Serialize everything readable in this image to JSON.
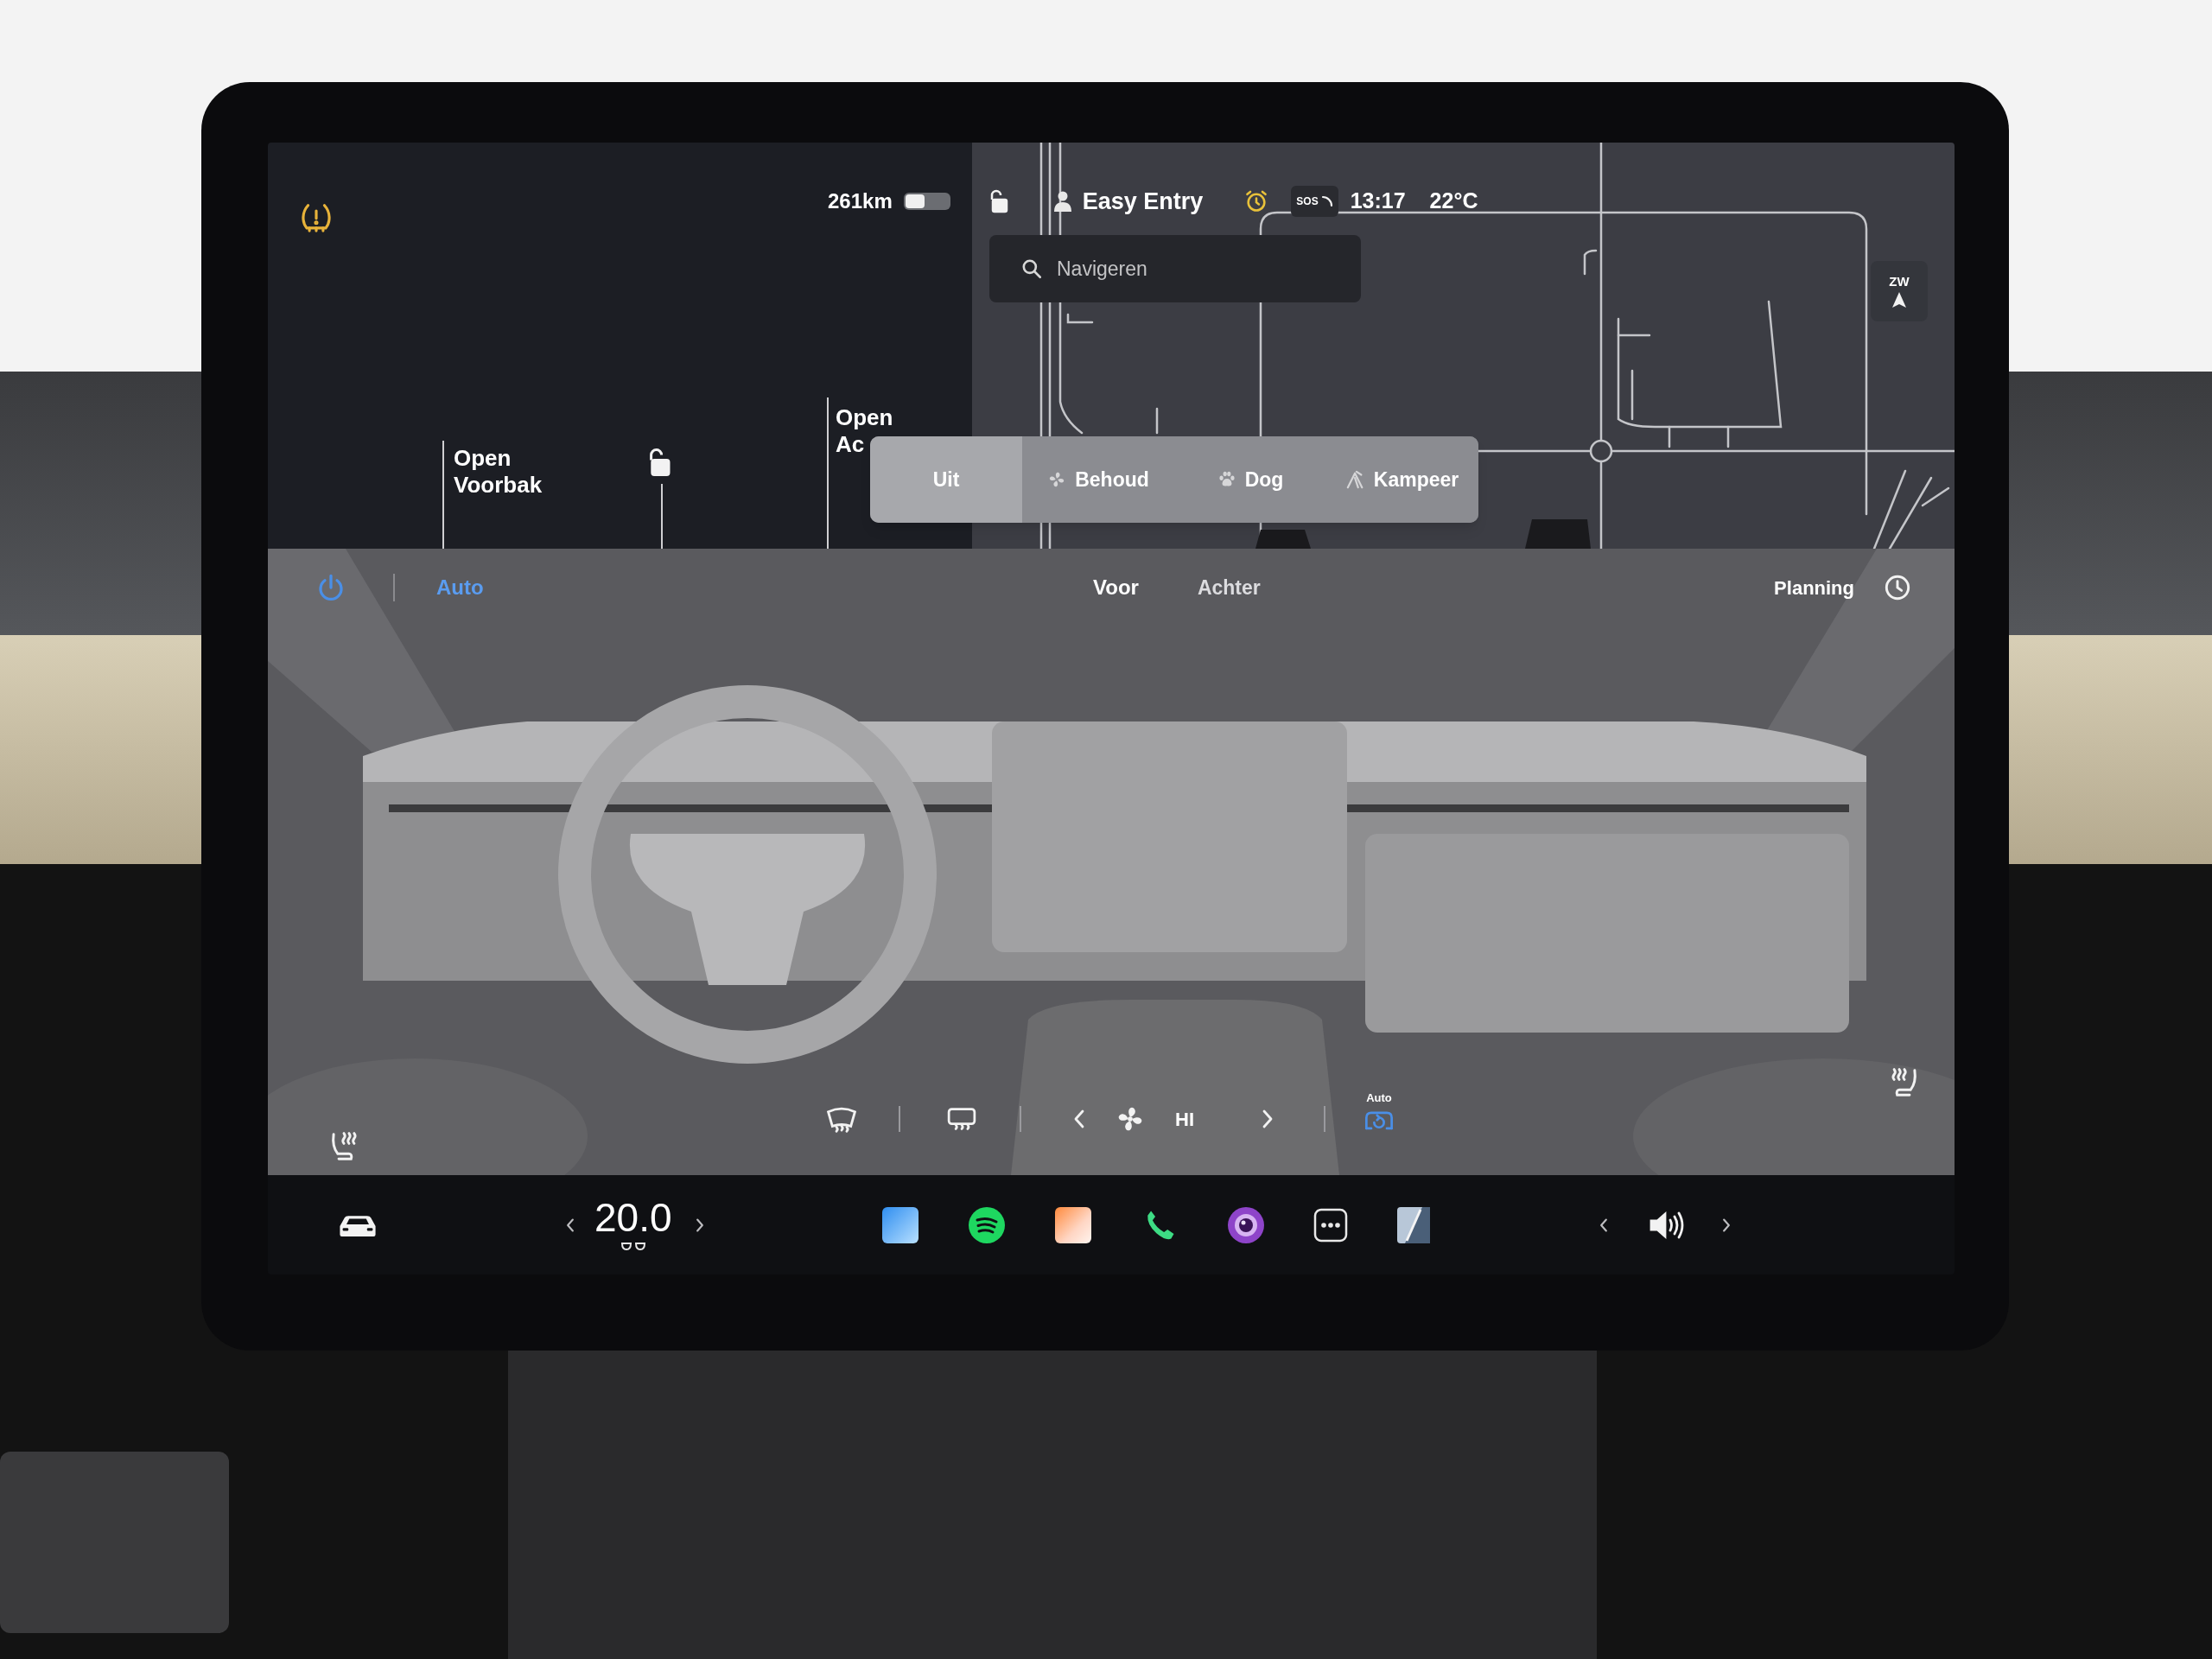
{
  "status_bar": {
    "range": "261km",
    "profile": "Easy Entry",
    "sos": "SOS",
    "time": "13:17",
    "temperature": "22°C"
  },
  "search": {
    "placeholder": "Navigeren"
  },
  "compass": {
    "heading": "ZW"
  },
  "trunk_labels": [
    {
      "lines": [
        "Open",
        "Voorbak"
      ]
    },
    {
      "lines": [
        "Open",
        "Ac"
      ]
    }
  ],
  "modes": [
    {
      "label": "Uit",
      "kind": "plain",
      "selected": true
    },
    {
      "label": "Behoud",
      "kind": "fan",
      "selected": false
    },
    {
      "label": "Dog",
      "kind": "paw",
      "selected": false
    },
    {
      "label": "Kampeer",
      "kind": "tent",
      "selected": false
    }
  ],
  "climate": {
    "power": {
      "on": true
    },
    "auto": {
      "label": "Auto",
      "on": true
    },
    "zones": [
      {
        "label": "Voor",
        "selected": true
      },
      {
        "label": "Achter",
        "selected": false
      }
    ],
    "planning": "Planning",
    "fan_speed": "HI",
    "recirculation": {
      "label": "Auto",
      "on": true
    }
  },
  "taskbar": {
    "cabin_temperature": "20.0"
  }
}
